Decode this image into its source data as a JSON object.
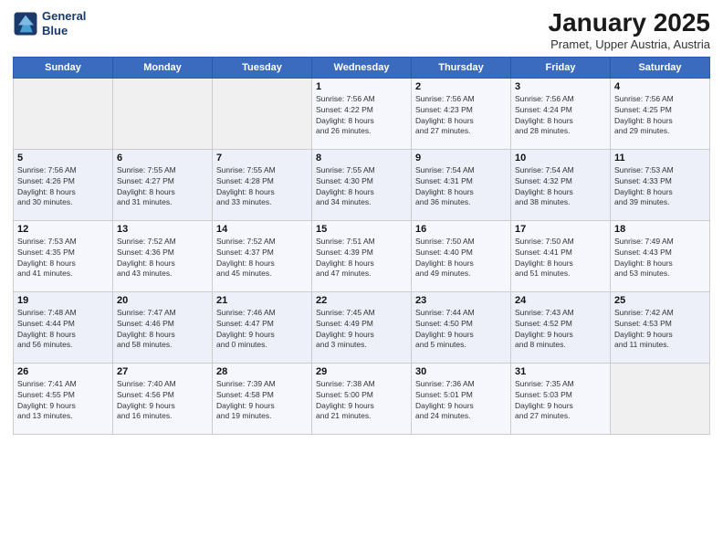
{
  "logo": {
    "line1": "General",
    "line2": "Blue"
  },
  "title": "January 2025",
  "subtitle": "Pramet, Upper Austria, Austria",
  "weekdays": [
    "Sunday",
    "Monday",
    "Tuesday",
    "Wednesday",
    "Thursday",
    "Friday",
    "Saturday"
  ],
  "weeks": [
    [
      {
        "day": "",
        "info": ""
      },
      {
        "day": "",
        "info": ""
      },
      {
        "day": "",
        "info": ""
      },
      {
        "day": "1",
        "info": "Sunrise: 7:56 AM\nSunset: 4:22 PM\nDaylight: 8 hours\nand 26 minutes."
      },
      {
        "day": "2",
        "info": "Sunrise: 7:56 AM\nSunset: 4:23 PM\nDaylight: 8 hours\nand 27 minutes."
      },
      {
        "day": "3",
        "info": "Sunrise: 7:56 AM\nSunset: 4:24 PM\nDaylight: 8 hours\nand 28 minutes."
      },
      {
        "day": "4",
        "info": "Sunrise: 7:56 AM\nSunset: 4:25 PM\nDaylight: 8 hours\nand 29 minutes."
      }
    ],
    [
      {
        "day": "5",
        "info": "Sunrise: 7:56 AM\nSunset: 4:26 PM\nDaylight: 8 hours\nand 30 minutes."
      },
      {
        "day": "6",
        "info": "Sunrise: 7:55 AM\nSunset: 4:27 PM\nDaylight: 8 hours\nand 31 minutes."
      },
      {
        "day": "7",
        "info": "Sunrise: 7:55 AM\nSunset: 4:28 PM\nDaylight: 8 hours\nand 33 minutes."
      },
      {
        "day": "8",
        "info": "Sunrise: 7:55 AM\nSunset: 4:30 PM\nDaylight: 8 hours\nand 34 minutes."
      },
      {
        "day": "9",
        "info": "Sunrise: 7:54 AM\nSunset: 4:31 PM\nDaylight: 8 hours\nand 36 minutes."
      },
      {
        "day": "10",
        "info": "Sunrise: 7:54 AM\nSunset: 4:32 PM\nDaylight: 8 hours\nand 38 minutes."
      },
      {
        "day": "11",
        "info": "Sunrise: 7:53 AM\nSunset: 4:33 PM\nDaylight: 8 hours\nand 39 minutes."
      }
    ],
    [
      {
        "day": "12",
        "info": "Sunrise: 7:53 AM\nSunset: 4:35 PM\nDaylight: 8 hours\nand 41 minutes."
      },
      {
        "day": "13",
        "info": "Sunrise: 7:52 AM\nSunset: 4:36 PM\nDaylight: 8 hours\nand 43 minutes."
      },
      {
        "day": "14",
        "info": "Sunrise: 7:52 AM\nSunset: 4:37 PM\nDaylight: 8 hours\nand 45 minutes."
      },
      {
        "day": "15",
        "info": "Sunrise: 7:51 AM\nSunset: 4:39 PM\nDaylight: 8 hours\nand 47 minutes."
      },
      {
        "day": "16",
        "info": "Sunrise: 7:50 AM\nSunset: 4:40 PM\nDaylight: 8 hours\nand 49 minutes."
      },
      {
        "day": "17",
        "info": "Sunrise: 7:50 AM\nSunset: 4:41 PM\nDaylight: 8 hours\nand 51 minutes."
      },
      {
        "day": "18",
        "info": "Sunrise: 7:49 AM\nSunset: 4:43 PM\nDaylight: 8 hours\nand 53 minutes."
      }
    ],
    [
      {
        "day": "19",
        "info": "Sunrise: 7:48 AM\nSunset: 4:44 PM\nDaylight: 8 hours\nand 56 minutes."
      },
      {
        "day": "20",
        "info": "Sunrise: 7:47 AM\nSunset: 4:46 PM\nDaylight: 8 hours\nand 58 minutes."
      },
      {
        "day": "21",
        "info": "Sunrise: 7:46 AM\nSunset: 4:47 PM\nDaylight: 9 hours\nand 0 minutes."
      },
      {
        "day": "22",
        "info": "Sunrise: 7:45 AM\nSunset: 4:49 PM\nDaylight: 9 hours\nand 3 minutes."
      },
      {
        "day": "23",
        "info": "Sunrise: 7:44 AM\nSunset: 4:50 PM\nDaylight: 9 hours\nand 5 minutes."
      },
      {
        "day": "24",
        "info": "Sunrise: 7:43 AM\nSunset: 4:52 PM\nDaylight: 9 hours\nand 8 minutes."
      },
      {
        "day": "25",
        "info": "Sunrise: 7:42 AM\nSunset: 4:53 PM\nDaylight: 9 hours\nand 11 minutes."
      }
    ],
    [
      {
        "day": "26",
        "info": "Sunrise: 7:41 AM\nSunset: 4:55 PM\nDaylight: 9 hours\nand 13 minutes."
      },
      {
        "day": "27",
        "info": "Sunrise: 7:40 AM\nSunset: 4:56 PM\nDaylight: 9 hours\nand 16 minutes."
      },
      {
        "day": "28",
        "info": "Sunrise: 7:39 AM\nSunset: 4:58 PM\nDaylight: 9 hours\nand 19 minutes."
      },
      {
        "day": "29",
        "info": "Sunrise: 7:38 AM\nSunset: 5:00 PM\nDaylight: 9 hours\nand 21 minutes."
      },
      {
        "day": "30",
        "info": "Sunrise: 7:36 AM\nSunset: 5:01 PM\nDaylight: 9 hours\nand 24 minutes."
      },
      {
        "day": "31",
        "info": "Sunrise: 7:35 AM\nSunset: 5:03 PM\nDaylight: 9 hours\nand 27 minutes."
      },
      {
        "day": "",
        "info": ""
      }
    ]
  ]
}
